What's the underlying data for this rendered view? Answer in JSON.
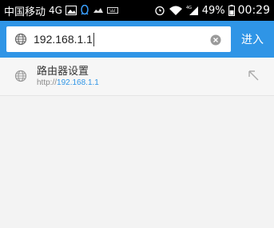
{
  "status_bar": {
    "carrier": "中国移动",
    "network": "4G",
    "battery": "49%",
    "time": "00:29",
    "icons": [
      "image-icon",
      "qq-icon",
      "cloud-icon",
      "keyboard-icon",
      "alarm-icon",
      "wifi-icon",
      "signal-icon",
      "battery-icon"
    ]
  },
  "search": {
    "url": "192.168.1.1",
    "go_label": "进入",
    "accent": "#2f95e6"
  },
  "suggestion": {
    "title": "路由器设置",
    "url_protocol": "http://",
    "url_host": "192.168.1.1"
  }
}
